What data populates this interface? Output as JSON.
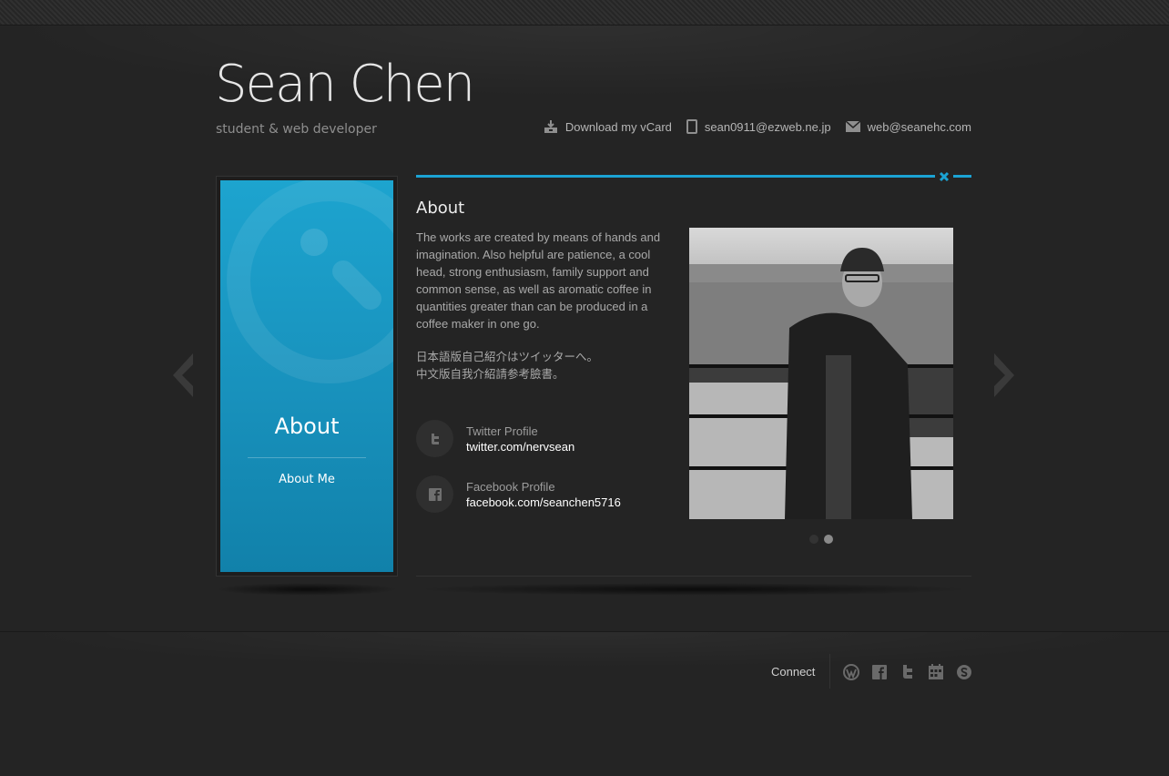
{
  "header": {
    "title": "Sean Chen",
    "subtitle": "student & web developer",
    "contacts": [
      {
        "icon": "download-icon",
        "label": "Download my vCard"
      },
      {
        "icon": "phone-icon",
        "label": "sean0911@ezweb.ne.jp"
      },
      {
        "icon": "mail-icon",
        "label": "web@seanehc.com"
      }
    ]
  },
  "sidebar": {
    "title": "About",
    "link": "About Me",
    "color": "#1a9cc8"
  },
  "main": {
    "section_title": "About",
    "paragraph": "The works are created by means of hands and imagination. Also helpful are patience, a cool head, strong enthusiasm, family support and common sense, as well as aromatic coffee in quantities greater than can be produced in a coffee maker in one go.",
    "jp_line1": "日本語版自己紹介はツイッターへ。",
    "jp_line2": "中文版自我介紹請参考臉書。",
    "profiles": [
      {
        "icon": "twitter-icon",
        "label": "Twitter Profile",
        "link": "twitter.com/nervsean"
      },
      {
        "icon": "facebook-icon",
        "label": "Facebook Profile",
        "link": "facebook.com/seanchen5716"
      }
    ],
    "slider": {
      "count": 2,
      "active": 2
    }
  },
  "footer": {
    "connect_label": "Connect",
    "social_icons": [
      "wordpress-icon",
      "facebook-icon",
      "twitter-icon",
      "calendar-icon",
      "skype-icon"
    ]
  },
  "colors": {
    "accent": "#1ba3d3",
    "background": "#242424"
  }
}
